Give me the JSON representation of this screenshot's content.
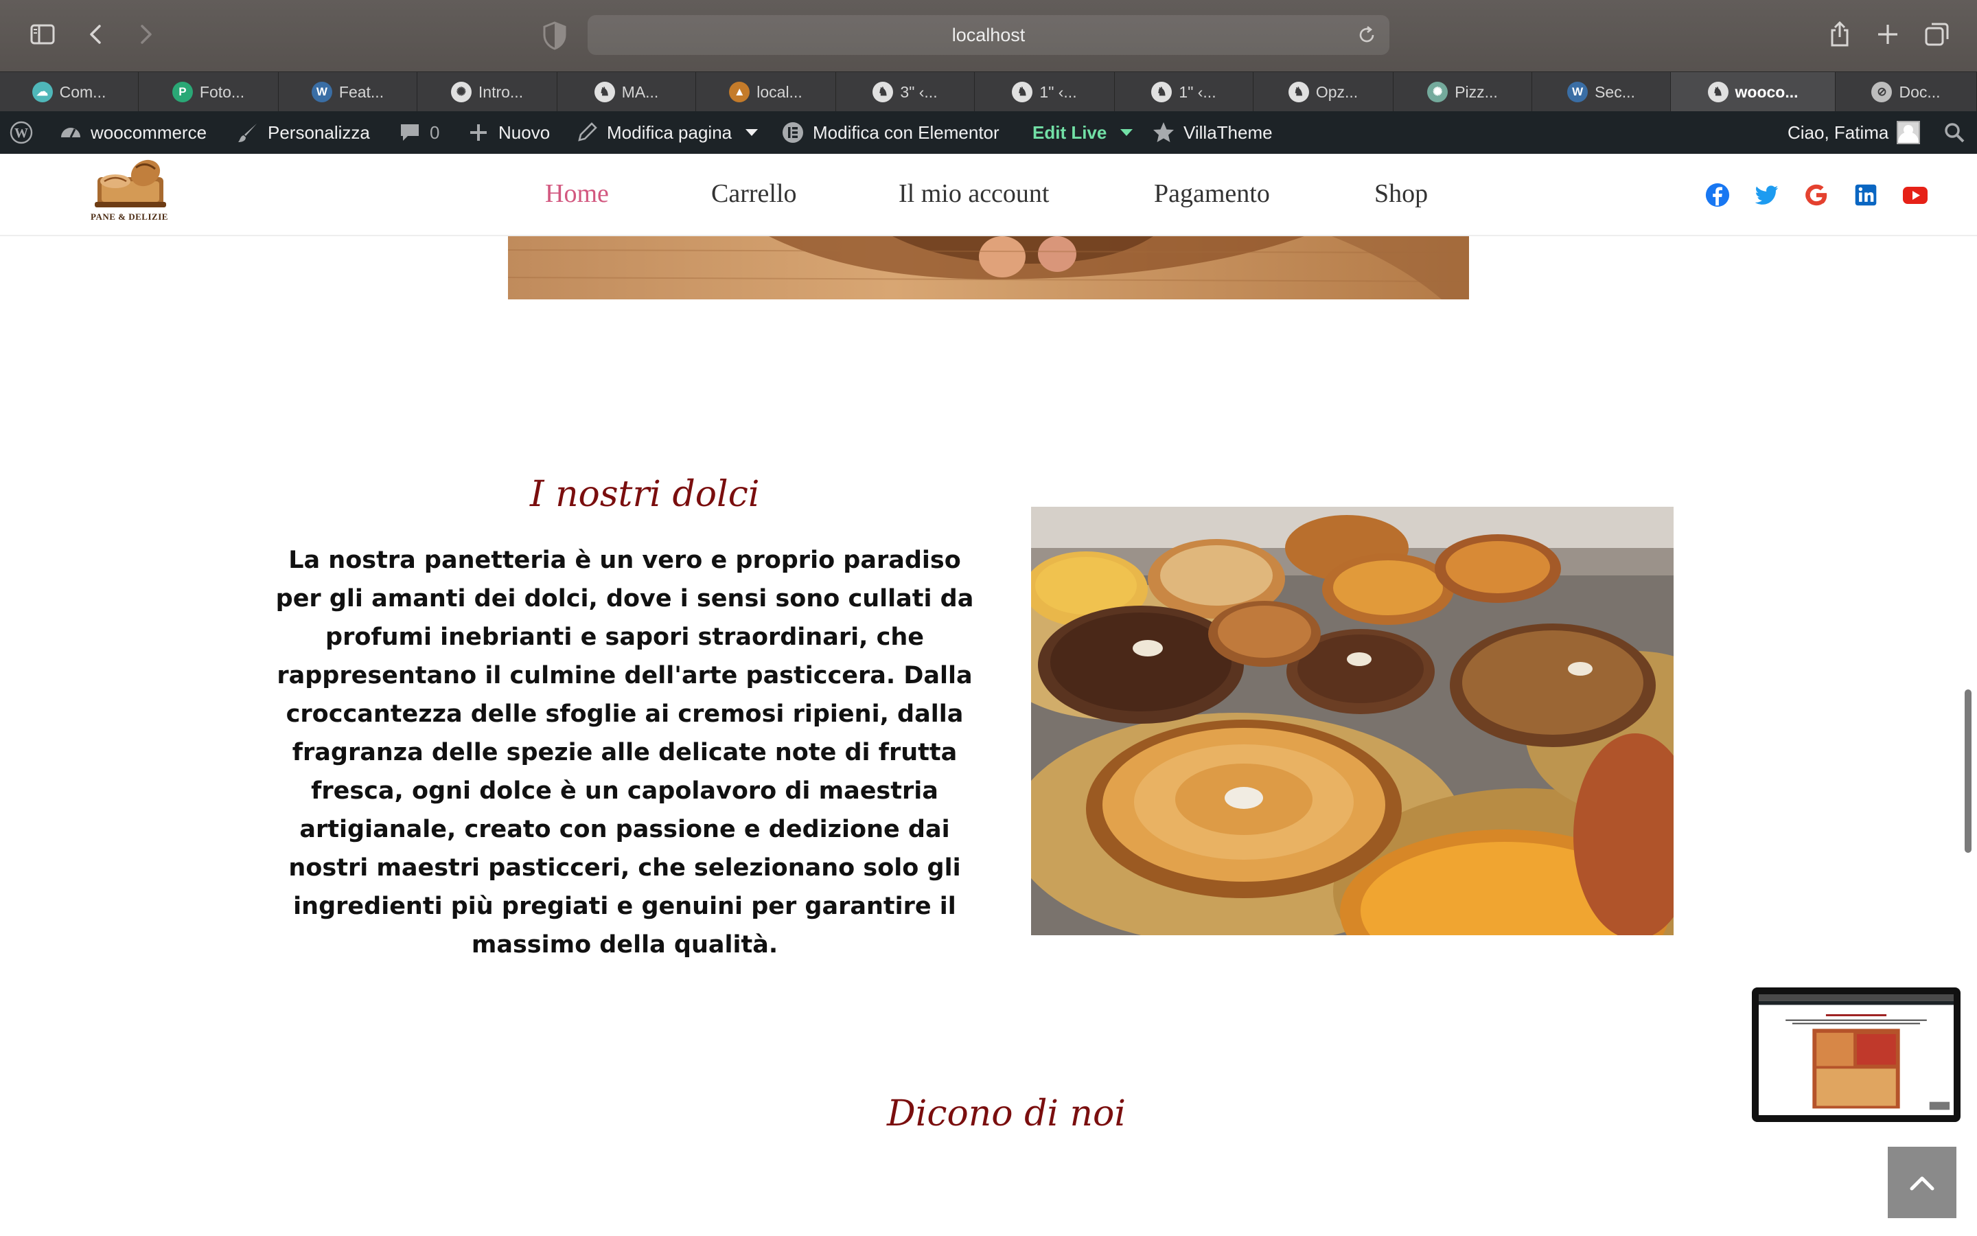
{
  "browser": {
    "url": "localhost",
    "tabs": [
      {
        "label": "Com...",
        "icon": "cloud-favicon",
        "color": "#4fb7b9"
      },
      {
        "label": "Foto...",
        "icon": "p-favicon",
        "color": "#2aa876"
      },
      {
        "label": "Feat...",
        "icon": "wordpress-favicon",
        "color": "#3a6ea5"
      },
      {
        "label": "Intro...",
        "icon": "openai-favicon",
        "color": "#e0e0e0"
      },
      {
        "label": "MA...",
        "icon": "tooth-favicon",
        "color": "#e0e0e0"
      },
      {
        "label": "local...",
        "icon": "mountain-favicon",
        "color": "#c47b2a"
      },
      {
        "label": "3\" ‹...",
        "icon": "tooth-favicon",
        "color": "#e0e0e0"
      },
      {
        "label": "1\" ‹...",
        "icon": "tooth-favicon",
        "color": "#e0e0e0"
      },
      {
        "label": "1\" ‹...",
        "icon": "tooth-favicon",
        "color": "#e0e0e0"
      },
      {
        "label": "Opz...",
        "icon": "tooth-favicon",
        "color": "#e0e0e0"
      },
      {
        "label": "Pizz...",
        "icon": "chatgpt-favicon",
        "color": "#74aa9c"
      },
      {
        "label": "Sec...",
        "icon": "wordpress-favicon",
        "color": "#3a6ea5"
      },
      {
        "label": "wooco...",
        "icon": "tooth-favicon",
        "color": "#e0e0e0"
      },
      {
        "label": "Doc...",
        "icon": "compass-favicon",
        "color": "#bdbdbd"
      }
    ]
  },
  "adminbar": {
    "site": "woocommerce",
    "customize": "Personalizza",
    "comments": "0",
    "new": "Nuovo",
    "edit_page": "Modifica pagina",
    "elementor": "Modifica con Elementor",
    "edit_live": "Edit Live",
    "villatheme": "VillaTheme",
    "greeting": "Ciao, Fatima"
  },
  "site": {
    "logo_text": "PANE & DELIZIE",
    "nav": [
      "Home",
      "Carrello",
      "Il mio account",
      "Pagamento",
      "Shop"
    ],
    "social": [
      "facebook-icon",
      "twitter-icon",
      "google-icon",
      "linkedin-icon",
      "youtube-icon"
    ]
  },
  "section": {
    "title": "I nostri dolci",
    "description": "La nostra panetteria è un vero e proprio paradiso per gli amanti dei dolci, dove i sensi sono cullati da profumi inebrianti e sapori straordinari, che rappresentano il culmine dell'arte pasticcera. Dalla croccantezza delle sfoglie ai cremosi ripieni, dalla fragranza delle spezie alle delicate note di frutta fresca, ogni dolce è un capolavoro di maestria artigianale, creato con passione e dedizione dai nostri maestri pasticceri, che selezionano solo gli ingredienti più pregiati e genuini per garantire il massimo della qualità."
  },
  "testimonials": {
    "title": "Dicono di noi"
  },
  "colors": {
    "accent_nav": "#d2577f",
    "title_red": "#7a0e0e",
    "admin_bar": "#1d2327",
    "edit_live": "#72e0a6"
  }
}
